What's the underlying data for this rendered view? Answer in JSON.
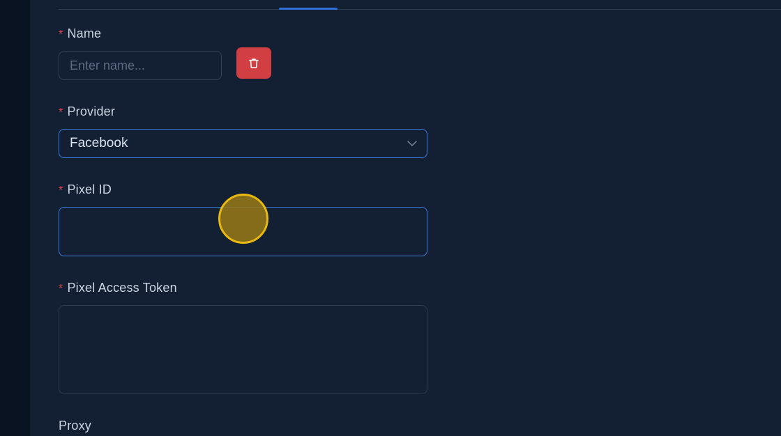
{
  "form": {
    "name": {
      "label": "Name",
      "required_mark": "*",
      "placeholder": "Enter name...",
      "value": ""
    },
    "delete_icon": "trash-icon",
    "provider": {
      "label": "Provider",
      "required_mark": "*",
      "selected": "Facebook"
    },
    "pixel_id": {
      "label": "Pixel ID",
      "required_mark": "*",
      "value": ""
    },
    "pixel_access_token": {
      "label": "Pixel Access Token",
      "required_mark": "*",
      "value": ""
    },
    "proxy": {
      "label": "Proxy"
    }
  },
  "colors": {
    "background": "#131f33",
    "accent": "#3f7fe6",
    "danger": "#d13f43",
    "required": "#e5484d"
  }
}
